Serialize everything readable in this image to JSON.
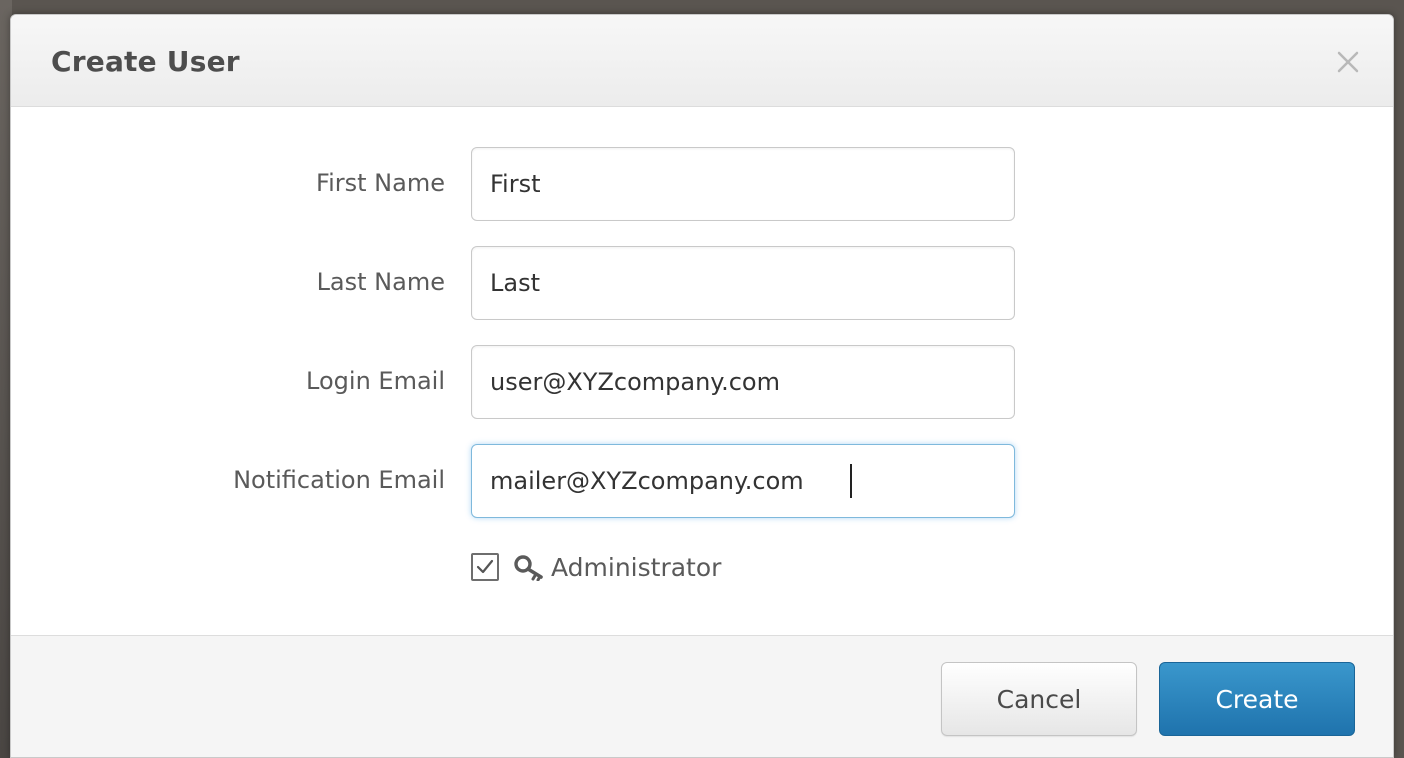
{
  "dialog": {
    "title": "Create User",
    "close_icon": "close-icon"
  },
  "form": {
    "fields": [
      {
        "label": "First Name",
        "value": "First"
      },
      {
        "label": "Last Name",
        "value": "Last"
      },
      {
        "label": "Login Email",
        "value": "user@XYZcompany.com"
      },
      {
        "label": "Notification Email",
        "value": "mailer@XYZcompany.com"
      }
    ],
    "administrator": {
      "label": "Administrator",
      "checked": true,
      "icon": "key-icon"
    }
  },
  "footer": {
    "cancel_label": "Cancel",
    "create_label": "Create"
  },
  "colors": {
    "primary": "#2a86c0",
    "focus_border": "#7fb9dc"
  }
}
